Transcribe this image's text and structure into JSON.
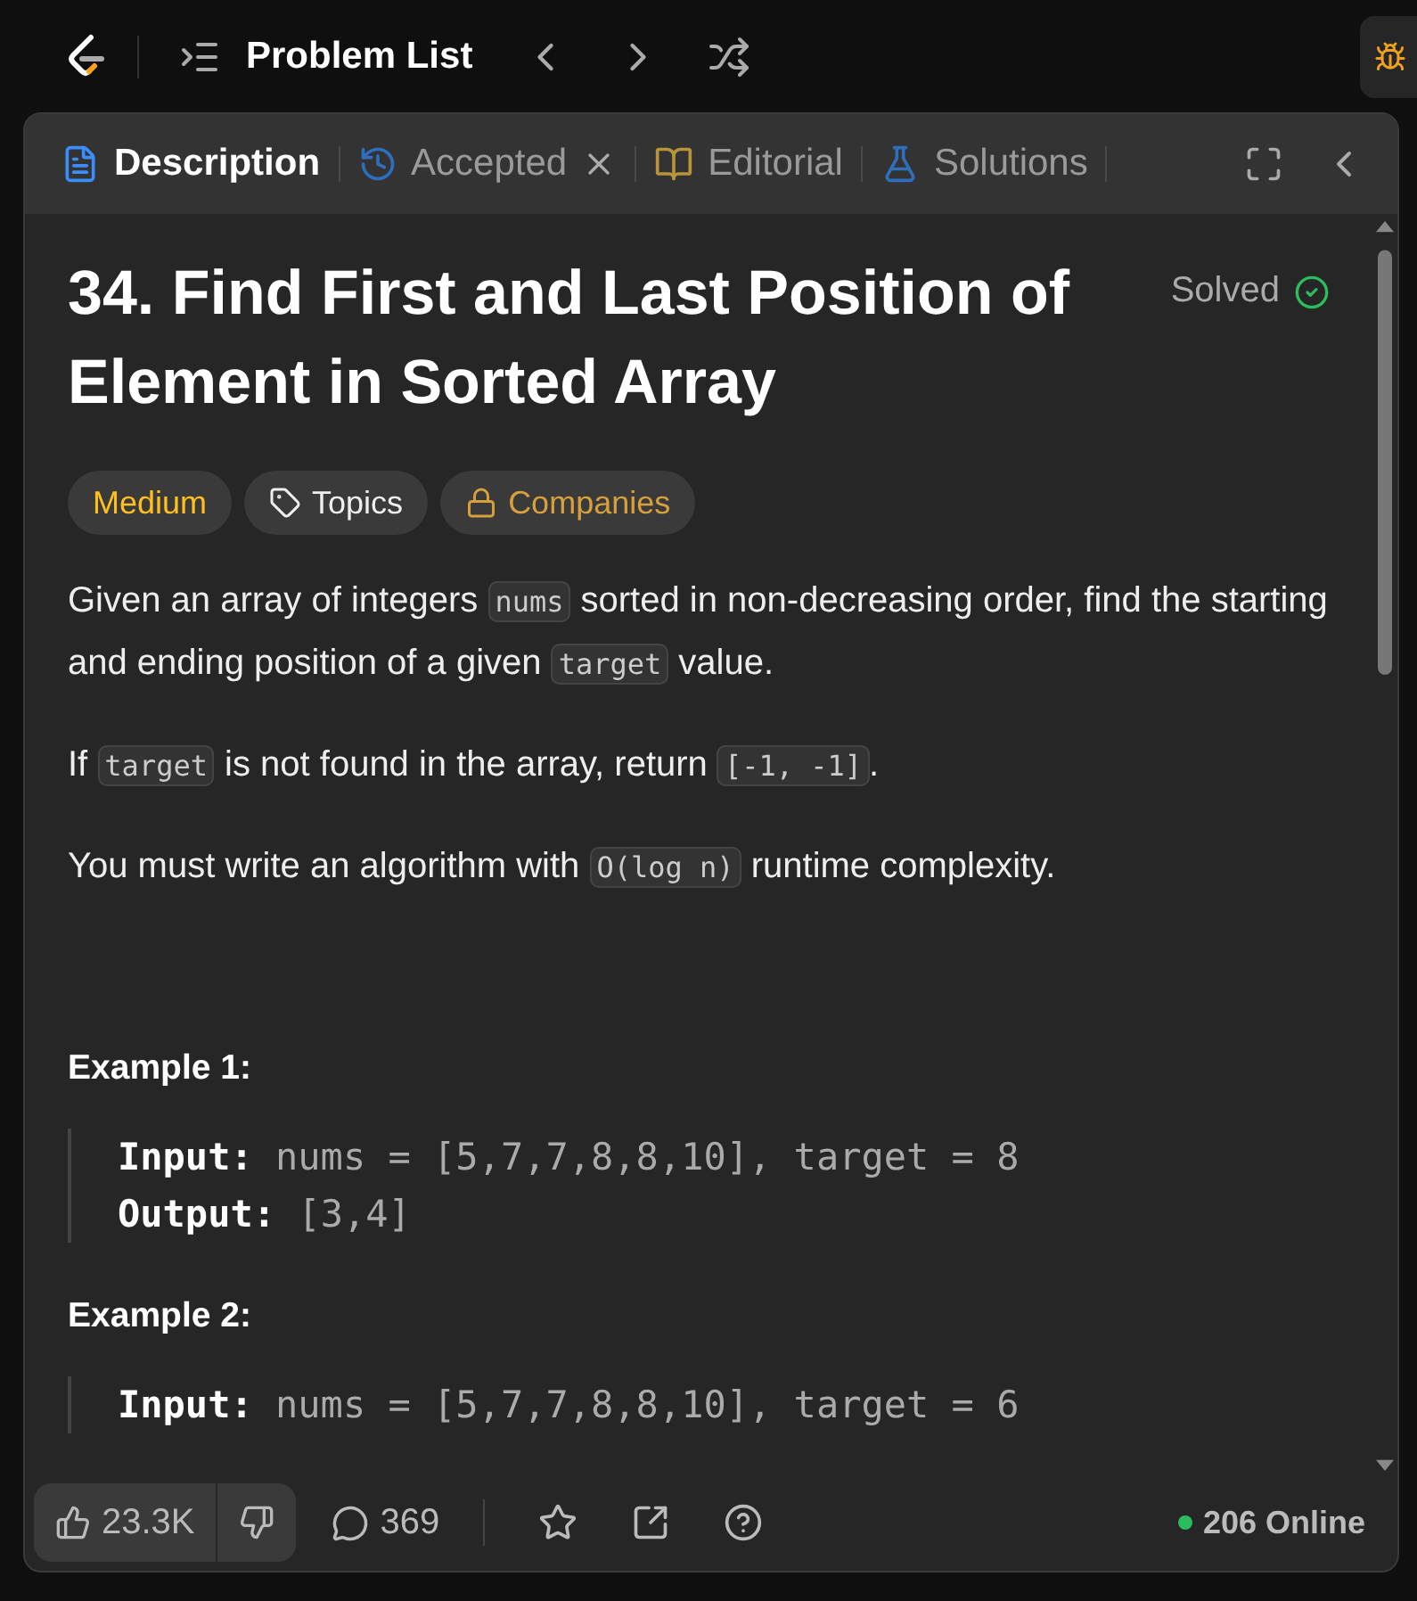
{
  "top_bar": {
    "title": "Problem List"
  },
  "tabs": [
    {
      "label": "Description",
      "selected": true,
      "closable": false
    },
    {
      "label": "Accepted",
      "selected": false,
      "closable": true
    },
    {
      "label": "Editorial",
      "selected": false,
      "closable": false
    },
    {
      "label": "Solutions",
      "selected": false,
      "closable": false
    }
  ],
  "problem": {
    "title": "34. Find First and Last Position of Element in Sorted Array",
    "status": "Solved",
    "solved": true
  },
  "tags": [
    {
      "label": "Medium",
      "kind": "difficulty"
    },
    {
      "label": "Topics",
      "kind": "topics"
    },
    {
      "label": "Companies",
      "kind": "companies"
    }
  ],
  "paragraphs": [
    [
      {
        "kind": "text",
        "text": "Given an array of integers "
      },
      {
        "kind": "code",
        "text": "nums"
      },
      {
        "kind": "text",
        "text": " sorted in non-decreasing order, find the starting and ending position of a given "
      },
      {
        "kind": "code",
        "text": "target"
      },
      {
        "kind": "text",
        "text": " value."
      }
    ],
    [
      {
        "kind": "text",
        "text": "If "
      },
      {
        "kind": "code",
        "text": "target"
      },
      {
        "kind": "text",
        "text": " is not found in the array, return "
      },
      {
        "kind": "code",
        "text": "[-1, -1]"
      },
      {
        "kind": "text",
        "text": "."
      }
    ],
    [
      {
        "kind": "text",
        "text": "You must write an algorithm with "
      },
      {
        "kind": "code",
        "text": "O(log n)"
      },
      {
        "kind": "text",
        "text": " runtime complexity."
      }
    ]
  ],
  "examples": [
    {
      "title": "Example 1:",
      "lines": [
        {
          "label": "Input:",
          "value": "nums = [5,7,7,8,8,10], target = 8"
        },
        {
          "label": "Output:",
          "value": "[3,4]"
        }
      ]
    },
    {
      "title": "Example 2:",
      "lines": [
        {
          "label": "Input:",
          "value": "nums = [5,7,7,8,8,10], target = 6"
        }
      ]
    }
  ],
  "footer": {
    "likes": "23.3K",
    "comments": "369",
    "online": "206 Online"
  }
}
